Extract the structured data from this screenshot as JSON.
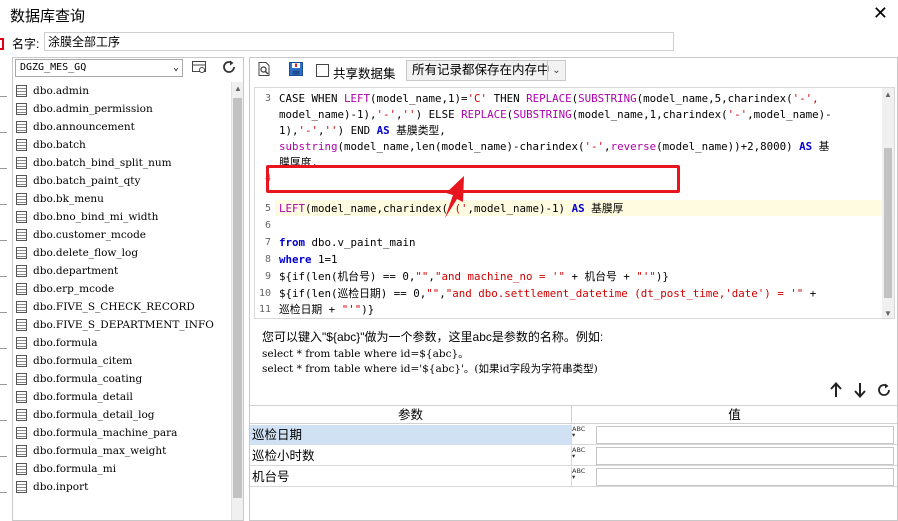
{
  "window": {
    "title": "数据库查询",
    "close_glyph": "✕"
  },
  "name_row": {
    "label": "名字:",
    "value": "涂膜全部工序"
  },
  "left_panel": {
    "database": "DGZG_MES_GQ",
    "tables": [
      "dbo.admin",
      "dbo.admin_permission",
      "dbo.announcement",
      "dbo.batch",
      "dbo.batch_bind_split_num",
      "dbo.batch_paint_qty",
      "dbo.bk_menu",
      "dbo.bno_bind_mi_width",
      "dbo.customer_mcode",
      "dbo.delete_flow_log",
      "dbo.department",
      "dbo.erp_mcode",
      "dbo.FIVE_S_CHECK_RECORD",
      "dbo.FIVE_S_DEPARTMENT_INFO",
      "dbo.formula",
      "dbo.formula_citem",
      "dbo.formula_coating",
      "dbo.formula_detail",
      "dbo.formula_detail_log",
      "dbo.formula_machine_para",
      "dbo.formula_max_weight",
      "dbo.formula_mi",
      "dbo.inport"
    ]
  },
  "toolbar": {
    "shared_dataset_label": "共享数据集",
    "memory_option": "所有记录都保存在内存中"
  },
  "editor": {
    "line_numbers": [
      "3",
      "4",
      "5",
      "6",
      "7",
      "8",
      "9",
      "10",
      "11"
    ],
    "highlight_color": "#e8141e"
  },
  "hint": {
    "line1": "您可以键入\"${abc}\"做为一个参数，这里abc是参数的名称。例如:",
    "line2": "select * from table where id=${abc}。",
    "line3": "select * from table where id='${abc}'。(如果id字段为字符串类型)"
  },
  "params": {
    "header_param": "参数",
    "header_value": "值",
    "type_icon_text": "ABC",
    "rows": [
      {
        "name": "巡检日期",
        "value": ""
      },
      {
        "name": "巡检小时数",
        "value": ""
      },
      {
        "name": "机台号",
        "value": ""
      }
    ]
  }
}
